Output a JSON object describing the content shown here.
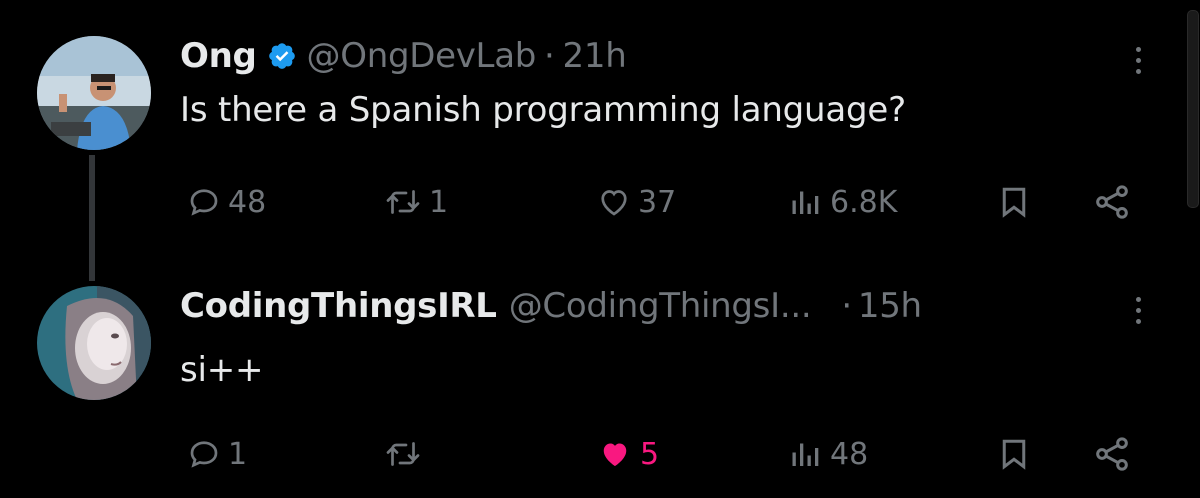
{
  "thread": {
    "tweets": [
      {
        "name": "Ong",
        "verified": true,
        "handle": "@OngDevLab",
        "time": "21h",
        "text": "Is there a Spanish programming language?",
        "stats": {
          "replies": "48",
          "retweets": "1",
          "likes": "37",
          "views": "6.8K"
        },
        "liked": false
      },
      {
        "name": "CodingThingsIRL",
        "verified": false,
        "handle": "@CodingThingsI...",
        "time": "15h",
        "text": "si++",
        "stats": {
          "replies": "1",
          "retweets": "",
          "likes": "5",
          "views": "48"
        },
        "liked": true
      }
    ],
    "separator": "·"
  },
  "icons": {
    "reply": "reply-icon",
    "retweet": "retweet-icon",
    "like": "heart-icon",
    "views": "views-icon",
    "bookmark": "bookmark-icon",
    "share": "share-icon",
    "verified": "verified-badge-icon",
    "more": "more-options-icon"
  },
  "colors": {
    "background": "#000000",
    "primary_text": "#e7e9ea",
    "secondary_text": "#71767b",
    "verified": "#1d9bf0",
    "like_active": "#f91880"
  }
}
